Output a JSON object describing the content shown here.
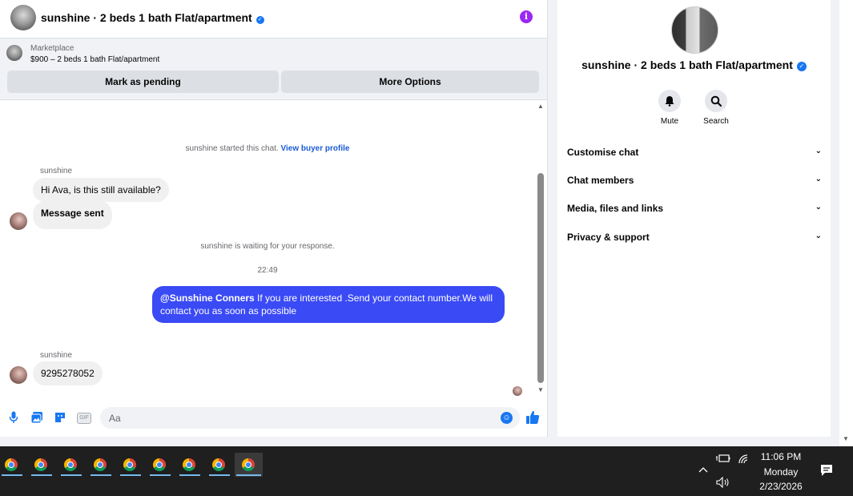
{
  "conversation": {
    "title": "sunshine · 2 beds 1 bath Flat/apartment",
    "info_icon": "info-icon"
  },
  "listing": {
    "source": "Marketplace",
    "price_title": "$900 – 2 beds 1 bath Flat/apartment",
    "mark_pending_label": "Mark as pending",
    "more_options_label": "More Options"
  },
  "messages": {
    "started_note": "sunshine started this chat.",
    "view_profile_link": "View buyer profile",
    "sender_1": "sunshine",
    "msg_1": "Hi Ava, is this still available?",
    "msg_2": "Message sent",
    "waiting_note": "sunshine is waiting for your response.",
    "time_separator": "22:49",
    "out_mention": "@Sunshine Conners",
    "out_text": " If you are interested .Send your contact number.We will contact you as soon as possible",
    "sender_2": "sunshine",
    "msg_3": "9295278052"
  },
  "composer": {
    "placeholder": "Aa",
    "icons": [
      "microphone-icon",
      "photo-icon",
      "sticker-icon",
      "gif-icon",
      "emoji-icon",
      "thumbs-up-icon"
    ],
    "gif_label": "GIF"
  },
  "info_panel": {
    "title": "sunshine · 2 beds 1 bath Flat/apartment",
    "mute_label": "Mute",
    "search_label": "Search",
    "sections": [
      "Customise chat",
      "Chat members",
      "Media, files and links",
      "Privacy & support"
    ]
  },
  "taskbar": {
    "apps": [
      "chrome",
      "chrome",
      "chrome",
      "chrome",
      "chrome",
      "chrome",
      "chrome",
      "chrome",
      "chrome"
    ],
    "time": "11:06 PM",
    "day": "Monday",
    "date": "2/23/2026"
  },
  "colors": {
    "accent_blue": "#1877f2",
    "outgoing_bubble": "#3a4af5",
    "info_purple": "#9b27f5"
  }
}
